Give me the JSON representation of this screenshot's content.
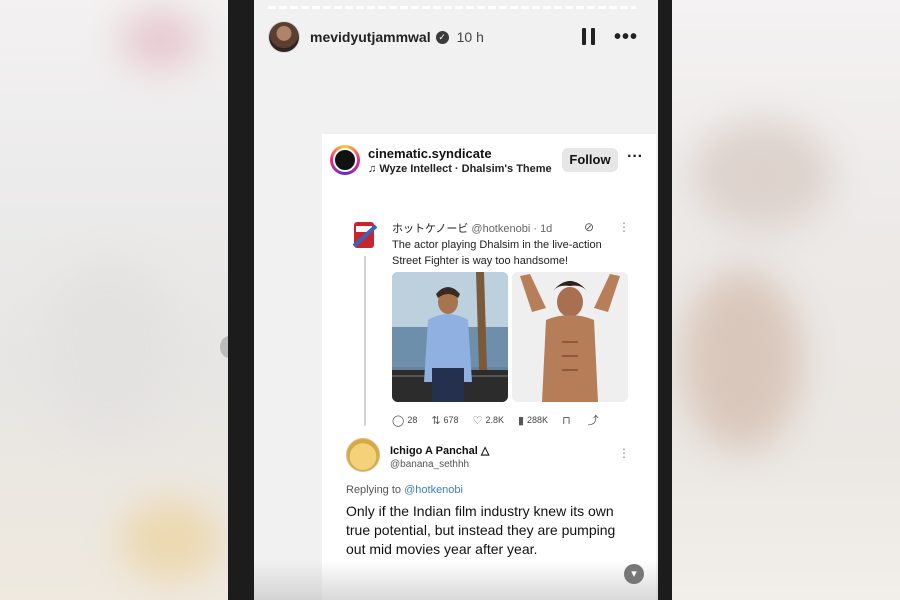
{
  "story": {
    "username": "mevidyutjammwal",
    "time_ago": "10 h"
  },
  "post": {
    "account": "cinematic.syndicate",
    "audio": "Wyze Intellect · Dhalsim's Theme",
    "follow_label": "Follow"
  },
  "tweet": {
    "name": "ホットケノービ",
    "handle": "@hotkenobi",
    "age": "· 1d",
    "text": "The actor playing Dhalsim in the live-action Street Fighter is way too handsome!",
    "stats": {
      "replies": "28",
      "retweets": "678",
      "likes": "2.8K",
      "views": "288K"
    }
  },
  "reply": {
    "name": "Ichigo A Panchal",
    "handle": "@banana_sethhh",
    "replying_label": "Replying to",
    "replying_handle": "@hotkenobi",
    "text": "Only if the Indian film industry knew its own true potential, but instead they are pumping out mid movies year after year."
  },
  "colors": {
    "link": "#3b82c4",
    "story_bg": "#1c1c1c",
    "follow_bg": "#e6e6e6"
  }
}
